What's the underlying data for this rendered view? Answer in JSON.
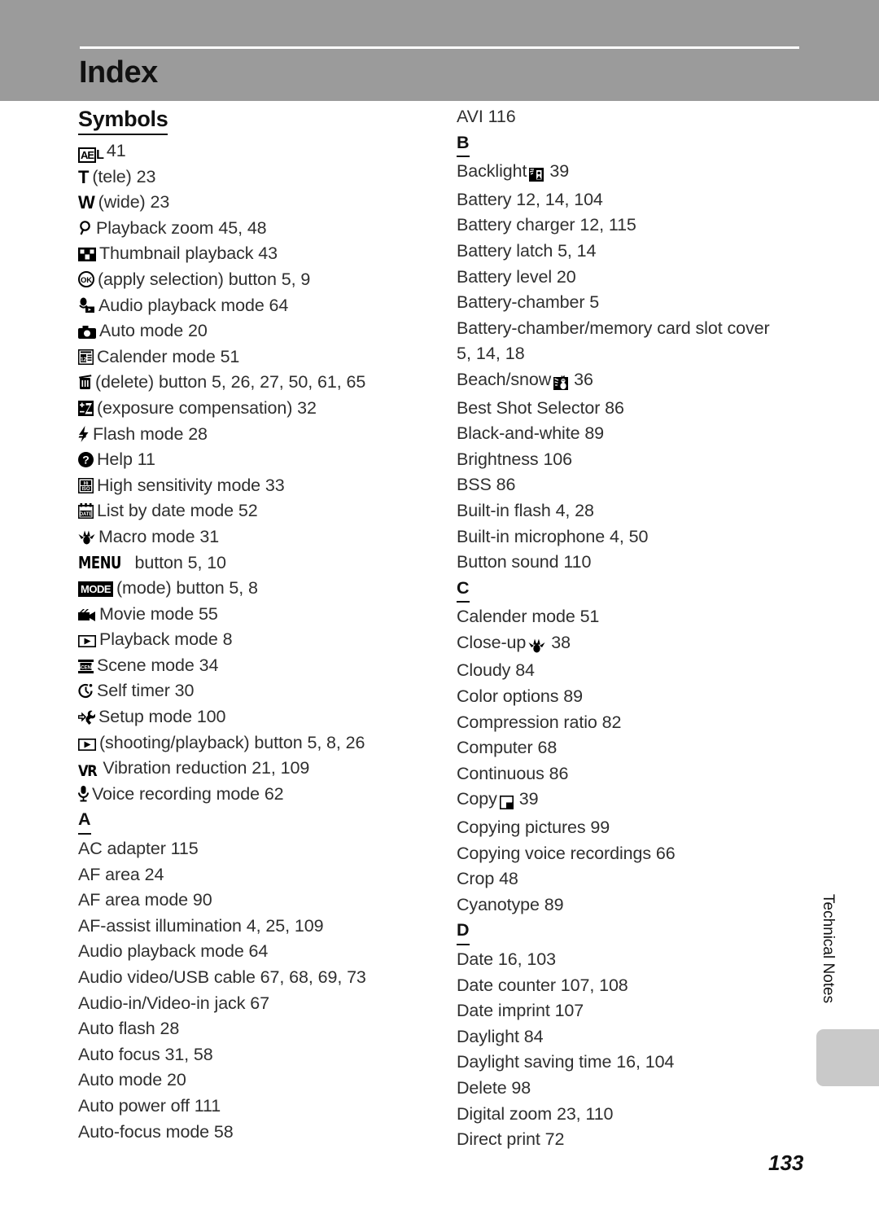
{
  "header": {
    "title": "Index"
  },
  "side_tab": {
    "label": "Technical Notes"
  },
  "page_number": "133",
  "columns": {
    "left": [
      {
        "kind": "section_word",
        "label": "Symbols"
      },
      {
        "kind": "entry",
        "icon": "ae-lock-icon",
        "text": "41"
      },
      {
        "kind": "entry",
        "icon": "tele-t-icon",
        "text": "(tele) 23"
      },
      {
        "kind": "entry",
        "icon": "wide-w-icon",
        "text": "(wide) 23"
      },
      {
        "kind": "entry",
        "icon": "magnifier-icon",
        "text": "Playback zoom 45, 48"
      },
      {
        "kind": "entry",
        "icon": "thumbnail-grid-icon",
        "text": "Thumbnail playback 43"
      },
      {
        "kind": "entry",
        "icon": "ok-button-icon",
        "text": "(apply selection) button 5, 9"
      },
      {
        "kind": "entry",
        "icon": "audio-playback-icon",
        "text": "Audio playback mode 64"
      },
      {
        "kind": "entry",
        "icon": "camera-auto-icon",
        "text": "Auto mode 20"
      },
      {
        "kind": "entry",
        "icon": "calendar-icon",
        "text": "Calender mode 51"
      },
      {
        "kind": "entry",
        "icon": "trash-icon",
        "text": "(delete) button 5, 26, 27, 50, 61, 65"
      },
      {
        "kind": "entry",
        "icon": "exposure-compensation-icon",
        "text": "(exposure compensation) 32"
      },
      {
        "kind": "entry",
        "icon": "flash-icon",
        "text": "Flash mode 28"
      },
      {
        "kind": "entry",
        "icon": "help-question-icon",
        "text": "Help 11"
      },
      {
        "kind": "entry",
        "icon": "hi-iso-icon",
        "text": "High sensitivity mode 33"
      },
      {
        "kind": "entry",
        "icon": "date-list-icon",
        "text": "List by date mode 52"
      },
      {
        "kind": "entry",
        "icon": "macro-flower-icon",
        "text": "Macro mode 31"
      },
      {
        "kind": "entry",
        "icon": "menu-button-icon",
        "text": "button 5, 10"
      },
      {
        "kind": "entry",
        "icon": "mode-button-icon",
        "text": "(mode) button 5, 8"
      },
      {
        "kind": "entry",
        "icon": "movie-camera-icon",
        "text": "Movie mode 55"
      },
      {
        "kind": "entry",
        "icon": "playback-triangle-icon",
        "text": "Playback mode 8"
      },
      {
        "kind": "entry",
        "icon": "scene-icon",
        "text": "Scene mode 34"
      },
      {
        "kind": "entry",
        "icon": "self-timer-icon",
        "text": "Self timer 30"
      },
      {
        "kind": "entry",
        "icon": "setup-wrench-icon",
        "text": "Setup mode 100"
      },
      {
        "kind": "entry",
        "icon": "playback-triangle-icon",
        "text": "(shooting/playback) button 5, 8, 26"
      },
      {
        "kind": "entry",
        "icon": "vr-icon",
        "text": "Vibration reduction 21, 109"
      },
      {
        "kind": "entry",
        "icon": "microphone-icon",
        "text": "Voice recording mode 62"
      },
      {
        "kind": "section_letter",
        "label": "A"
      },
      {
        "kind": "entry",
        "text": "AC adapter 115"
      },
      {
        "kind": "entry",
        "text": "AF area 24"
      },
      {
        "kind": "entry",
        "text": "AF area mode 90"
      },
      {
        "kind": "entry",
        "text": "AF-assist illumination 4, 25, 109"
      },
      {
        "kind": "entry",
        "text": "Audio playback mode 64"
      },
      {
        "kind": "entry",
        "text": "Audio video/USB cable 67, 68, 69, 73"
      },
      {
        "kind": "entry",
        "text": "Audio-in/Video-in jack 67"
      },
      {
        "kind": "entry",
        "text": "Auto flash 28"
      },
      {
        "kind": "entry",
        "text": "Auto focus 31, 58"
      },
      {
        "kind": "entry",
        "text": "Auto mode 20"
      },
      {
        "kind": "entry",
        "text": "Auto power off 111"
      },
      {
        "kind": "entry",
        "text": "Auto-focus mode 58"
      }
    ],
    "right": [
      {
        "kind": "entry",
        "text": "AVI 116"
      },
      {
        "kind": "section_letter",
        "label": "B"
      },
      {
        "kind": "entry",
        "text": "Backlight",
        "inline_icon": "backlight-icon",
        "text_after": "39"
      },
      {
        "kind": "entry",
        "text": "Battery 12, 14, 104"
      },
      {
        "kind": "entry",
        "text": "Battery charger 12, 115"
      },
      {
        "kind": "entry",
        "text": "Battery latch 5, 14"
      },
      {
        "kind": "entry",
        "text": "Battery level 20"
      },
      {
        "kind": "entry",
        "text": "Battery-chamber 5"
      },
      {
        "kind": "entry",
        "text": "Battery-chamber/memory card slot cover"
      },
      {
        "kind": "cont",
        "text": "5, 14, 18"
      },
      {
        "kind": "entry",
        "text": "Beach/snow",
        "inline_icon": "beach-snow-icon",
        "text_after": "36"
      },
      {
        "kind": "entry",
        "text": "Best Shot Selector 86"
      },
      {
        "kind": "entry",
        "text": "Black-and-white 89"
      },
      {
        "kind": "entry",
        "text": "Brightness 106"
      },
      {
        "kind": "entry",
        "text": "BSS 86"
      },
      {
        "kind": "entry",
        "text": "Built-in flash 4, 28"
      },
      {
        "kind": "entry",
        "text": "Built-in microphone 4, 50"
      },
      {
        "kind": "entry",
        "text": "Button sound 110"
      },
      {
        "kind": "section_letter",
        "label": "C"
      },
      {
        "kind": "entry",
        "text": "Calender mode 51"
      },
      {
        "kind": "entry",
        "text": "Close-up",
        "inline_icon": "macro-flower-icon",
        "text_after": "38"
      },
      {
        "kind": "entry",
        "text": "Cloudy 84"
      },
      {
        "kind": "entry",
        "text": "Color options 89"
      },
      {
        "kind": "entry",
        "text": "Compression ratio 82"
      },
      {
        "kind": "entry",
        "text": "Computer 68"
      },
      {
        "kind": "entry",
        "text": "Continuous 86"
      },
      {
        "kind": "entry",
        "text": "Copy",
        "inline_icon": "copy-icon",
        "text_after": "39"
      },
      {
        "kind": "entry",
        "text": "Copying pictures 99"
      },
      {
        "kind": "entry",
        "text": "Copying voice recordings 66"
      },
      {
        "kind": "entry",
        "text": "Crop 48"
      },
      {
        "kind": "entry",
        "text": "Cyanotype 89"
      },
      {
        "kind": "section_letter",
        "label": "D"
      },
      {
        "kind": "entry",
        "text": "Date 16, 103"
      },
      {
        "kind": "entry",
        "text": "Date counter 107, 108"
      },
      {
        "kind": "entry",
        "text": "Date imprint 107"
      },
      {
        "kind": "entry",
        "text": "Daylight 84"
      },
      {
        "kind": "entry",
        "text": "Daylight saving time 16, 104"
      },
      {
        "kind": "entry",
        "text": "Delete 98"
      },
      {
        "kind": "entry",
        "text": "Digital zoom 23, 110"
      },
      {
        "kind": "entry",
        "text": "Direct print 72"
      }
    ]
  },
  "colors": {
    "header_band": "#9b9b9b",
    "header_rule": "#ffffff",
    "text": "#2f2f2f",
    "side_tab": "#c9c9c9"
  }
}
